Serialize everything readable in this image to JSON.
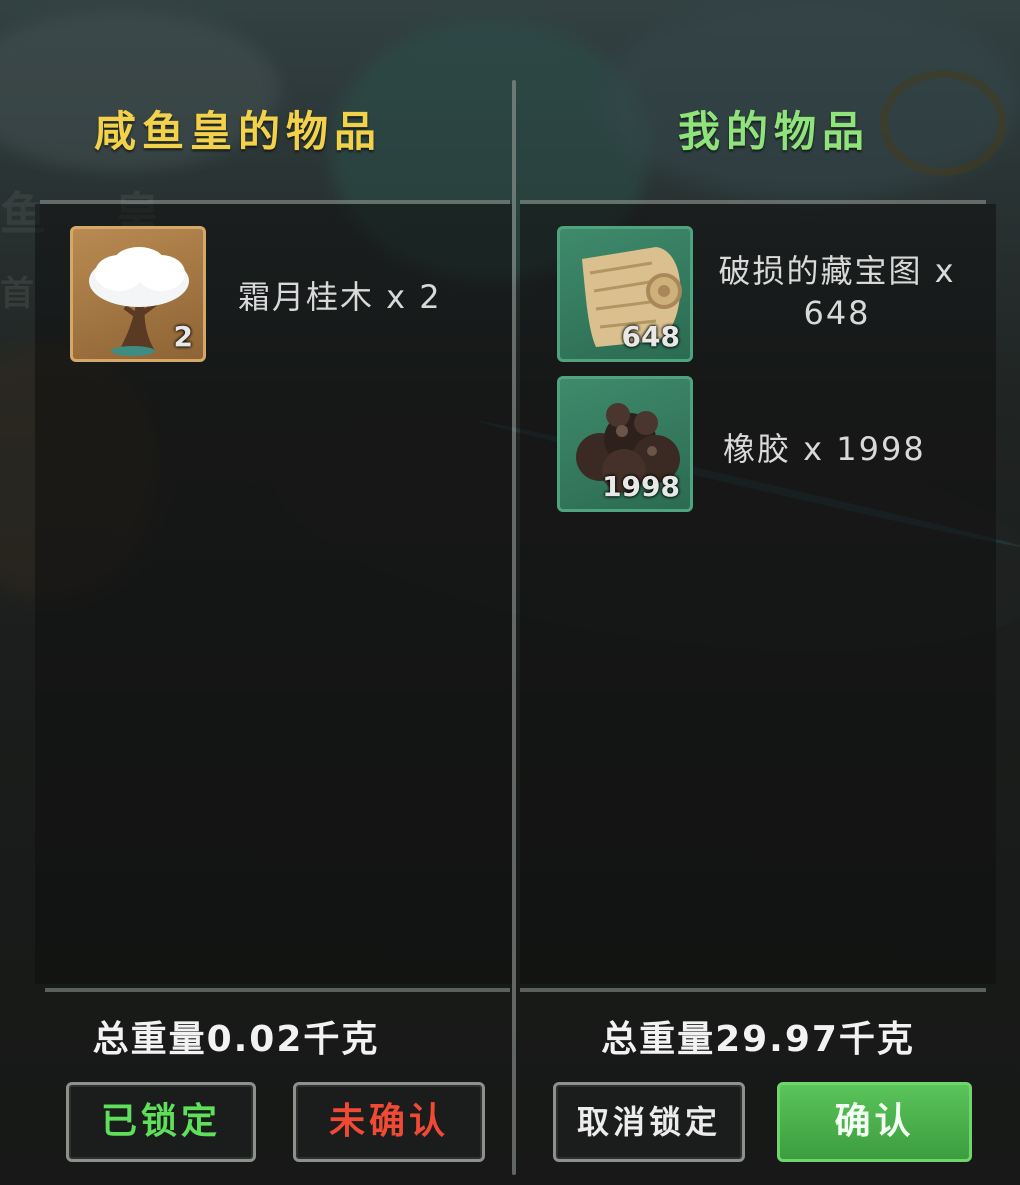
{
  "background": {
    "glyph_top": "鱼 皇",
    "glyph_bottom": "首"
  },
  "partner": {
    "title": "咸鱼皇的物品",
    "items": [
      {
        "name": "霜月桂木 x 2",
        "count": "2",
        "icon": "frost-laurel-wood-icon"
      }
    ],
    "total_weight": "总重量0.02千克",
    "status_lock": "已锁定",
    "status_confirm": "未确认"
  },
  "mine": {
    "title": "我的物品",
    "items": [
      {
        "name": "破损的藏宝图 x 648",
        "count": "648",
        "icon": "treasure-map-scroll-icon"
      },
      {
        "name": "橡胶 x 1998",
        "count": "1998",
        "icon": "rubber-icon"
      }
    ],
    "total_weight": "总重量29.97千克",
    "unlock_button": "取消锁定",
    "confirm_button": "确认"
  },
  "colors": {
    "partner_title": "#f2d24a",
    "mine_title": "#8fe37a",
    "locked_text": "#5ee05a",
    "unconfirmed_text": "#f04a35",
    "confirm_button_bg": "#4cb04c"
  }
}
